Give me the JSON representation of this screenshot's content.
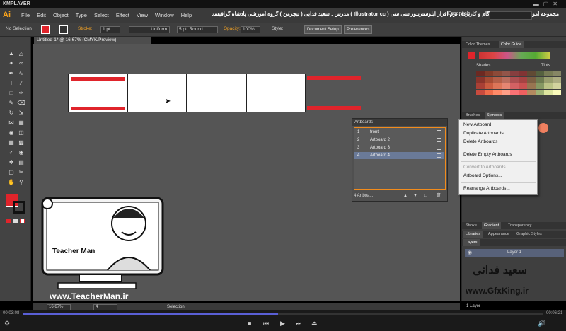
{
  "player": {
    "brand": "KMPLAYER",
    "time_elapsed": "00:03:08",
    "time_total": "00:06:21",
    "progress_fraction": 0.49
  },
  "menubar": {
    "app_icon": "Ai",
    "menus": [
      "File",
      "Edit",
      "Object",
      "Type",
      "Select",
      "Effect",
      "View",
      "Window",
      "Help"
    ],
    "banner": "مجموعه آموزشی جامع ، گام به گام و کاربردی نرم افزار ایلوستریتور سی سی ( Illustrator cc )  مدرس : سعید فدایی ( تیچرمن ) گروه آموزشی پادشاه گرافیست ها",
    "workspace": "Essentials"
  },
  "controlbar": {
    "selection": "No Selection",
    "stroke_label": "Stroke:",
    "stroke_value": "1 pt",
    "uniform": "Uniform",
    "brush": "5 pt. Round",
    "opacity_label": "Opacity:",
    "opacity_value": "100%",
    "style_label": "Style:",
    "doc_setup": "Document Setup",
    "preferences": "Preferences"
  },
  "document": {
    "tab_title": "Untitled-1* @ 16.67% (CMYK/Preview)"
  },
  "artboards_panel": {
    "title": "Artboards",
    "rows": [
      {
        "num": "1",
        "name": "front"
      },
      {
        "num": "2",
        "name": "Artboard 2"
      },
      {
        "num": "3",
        "name": "Artboard 3"
      },
      {
        "num": "4",
        "name": "Artboard 4"
      }
    ],
    "footer": "4 Artboa..."
  },
  "context_menu": {
    "items": [
      "New Artboard",
      "Duplicate Artboards",
      "Delete Artboards",
      "Delete Empty Artboards",
      "Convert to Artboards",
      "Artboard Options...",
      "Rearrange Artboards..."
    ]
  },
  "right_panels": {
    "color_tabs": [
      "Color Themes",
      "Color Guide"
    ],
    "shades_label": "Shades",
    "tints_label": "Tints",
    "brush_tabs": [
      "Brushes",
      "Symbols"
    ],
    "stroke_tabs": [
      "Stroke",
      "Gradient",
      "Transparency"
    ],
    "lib_tabs": [
      "Libraries",
      "Appearance",
      "Graphic Styles"
    ],
    "layers_title": "Layers",
    "layer_name": "Layer 1",
    "layers_footer": "1 Layer"
  },
  "statusbar": {
    "zoom": "16.67%",
    "page": "4",
    "tool": "Selection"
  },
  "watermarks": {
    "teacher_url": "www.TeacherMan.ir",
    "teacher_logo": "Teacher Man",
    "gfx_name": "سعید فدائی",
    "gfx_url": "www.GfxKing.ir"
  },
  "colors": {
    "accent_red": "#e0242b",
    "panel_highlight": "#f28c1c",
    "seek_fill": "#5a5fd6"
  }
}
